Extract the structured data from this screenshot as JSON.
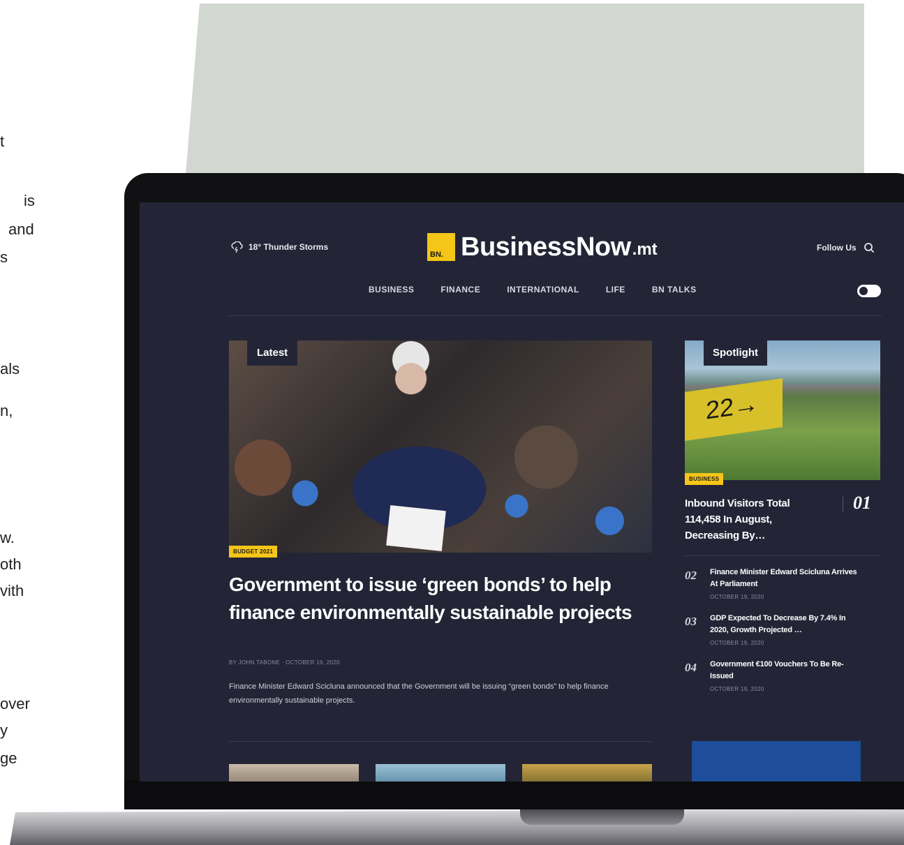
{
  "side_text": [
    "t",
    "is",
    "and",
    "s",
    "als",
    "n,",
    "w.",
    "oth",
    "vith",
    "over",
    "y",
    "ge"
  ],
  "header": {
    "weather": "18° Thunder Storms",
    "logo_mark": "BN.",
    "logo_word": "BusinessNow",
    "logo_tld": ".mt",
    "follow": "Follow Us"
  },
  "nav": [
    "BUSINESS",
    "FINANCE",
    "INTERNATIONAL",
    "LIFE",
    "BN TALKS"
  ],
  "latest": {
    "tag": "Latest",
    "badge": "BUDGET 2021",
    "headline": "Government to issue ‘green bonds’ to help finance environmentally sustainable projects",
    "byline": "BY JOHN TABONE · OCTOBER 19, 2020",
    "summary": "Finance Minister Edward Scicluna announced that the Government will be issuing “green bonds” to help finance environmentally sustainable projects."
  },
  "spotlight": {
    "tag": "Spotlight",
    "sign_text": "22→",
    "badge": "BUSINESS",
    "title": "Inbound Visitors Total 114,458 In August, Decreasing By…",
    "number": "01"
  },
  "ranked": [
    {
      "num": "02",
      "title": "Finance Minister Edward Scicluna Arrives At Parliament",
      "date": "OCTOBER 19, 2020"
    },
    {
      "num": "03",
      "title": "GDP Expected To Decrease By 7.4% In 2020, Growth Projected …",
      "date": "OCTOBER 19, 2020"
    },
    {
      "num": "04",
      "title": "Government €100 Vouchers To Be Re-Issued",
      "date": "OCTOBER 19, 2020"
    }
  ],
  "colors": {
    "accent": "#f5c518",
    "screen_bg": "#232536",
    "backdrop": "#d3d7d1"
  }
}
